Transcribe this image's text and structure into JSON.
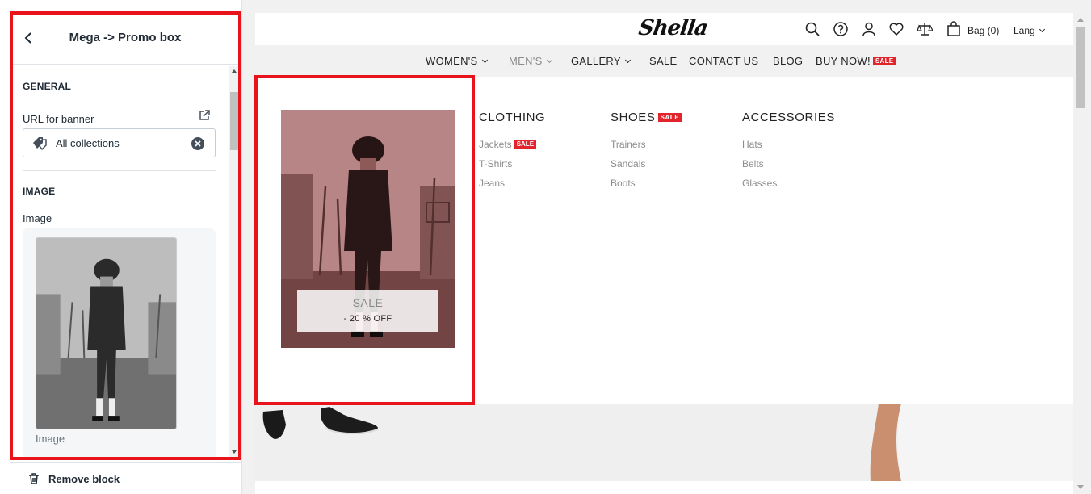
{
  "sidebar": {
    "title": "Mega -> Promo box",
    "general_heading": "GENERAL",
    "url_label": "URL for banner",
    "url_value": "All collections",
    "image_heading": "IMAGE",
    "image_label": "Image",
    "image_caption": "Image",
    "remove_block_label": "Remove block"
  },
  "store": {
    "logo": "Shella",
    "bag_label": "Bag (0)",
    "lang_label": "Lang",
    "nav": [
      {
        "label": "WOMEN'S"
      },
      {
        "label": "MEN'S"
      },
      {
        "label": "GALLERY"
      },
      {
        "label": "SALE"
      },
      {
        "label": "CONTACT US"
      },
      {
        "label": "BLOG"
      },
      {
        "label": "BUY NOW!"
      }
    ],
    "sale_badge": "SALE",
    "promo": {
      "title": "SALE",
      "subtitle": "- 20 % OFF"
    },
    "columns": [
      {
        "heading": "CLOTHING",
        "links": [
          "Jackets",
          "T-Shirts",
          "Jeans"
        ]
      },
      {
        "heading": "SHOES",
        "links": [
          "Trainers",
          "Sandals",
          "Boots"
        ]
      },
      {
        "heading": "ACCESSORIES",
        "links": [
          "Hats",
          "Belts",
          "Glasses"
        ]
      }
    ]
  },
  "colors": {
    "highlight": "#e8131b",
    "badge": "#e2242c",
    "promo_tint": "#d68080"
  }
}
